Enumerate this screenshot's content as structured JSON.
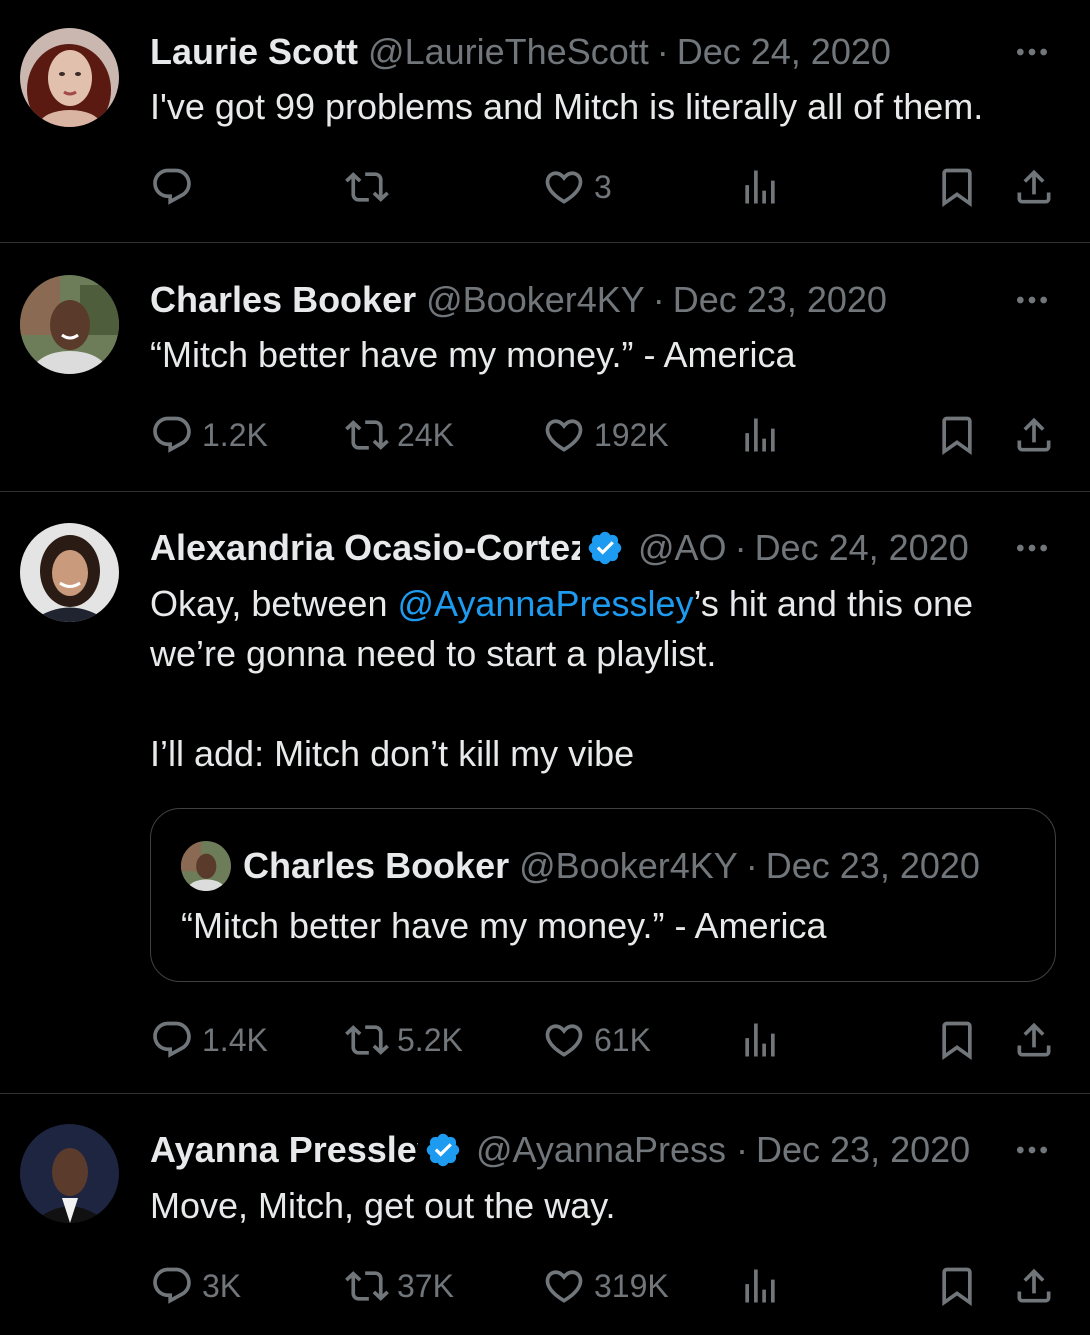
{
  "tweets": [
    {
      "name": "Laurie Scott",
      "handle": "@LaurieTheScott",
      "sep": "·",
      "date": "Dec 24, 2020",
      "text": "I've got 99 problems and Mitch is literally all of them.",
      "replies": "",
      "retweets": "",
      "likes": "3"
    },
    {
      "name": "Charles Booker",
      "handle": "@Booker4KY",
      "sep": "·",
      "date": "Dec 23, 2020",
      "text": "“Mitch better have my money.” - America",
      "replies": "1.2K",
      "retweets": "24K",
      "likes": "192K"
    },
    {
      "name": "Alexandria Ocasio-Cortez",
      "handle": "@AO",
      "sep": "·",
      "date": "Dec 24, 2020",
      "text_before": "Okay, between ",
      "mention": "@AyannaPressley",
      "text_after": "’s hit and this one\nwe’re gonna need to start a playlist.\n\nI’ll add: Mitch don’t kill my vibe",
      "quote": {
        "name": "Charles Booker",
        "handle": "@Booker4KY",
        "sep": "·",
        "date": "Dec 23, 2020",
        "text": "“Mitch better have my money.” - America"
      },
      "replies": "1.4K",
      "retweets": "5.2K",
      "likes": "61K"
    },
    {
      "name": "Ayanna Pressley",
      "handle": "@AyannaPressley",
      "sep": "·",
      "date": "Dec 23, 2020",
      "text": "Move, Mitch, get out the way.",
      "replies": "3K",
      "retweets": "37K",
      "likes": "319K"
    }
  ],
  "icons": {
    "reply": "reply-icon",
    "retweet": "retweet-icon",
    "like": "heart-icon",
    "views": "views-icon",
    "bookmark": "bookmark-icon",
    "share": "share-icon",
    "more": "more-icon",
    "verified": "verified-badge-icon"
  },
  "colors": {
    "background": "#000000",
    "text": "#e7e9ea",
    "muted": "#71767b",
    "link": "#1d9bf0",
    "divider": "#2f3336"
  }
}
